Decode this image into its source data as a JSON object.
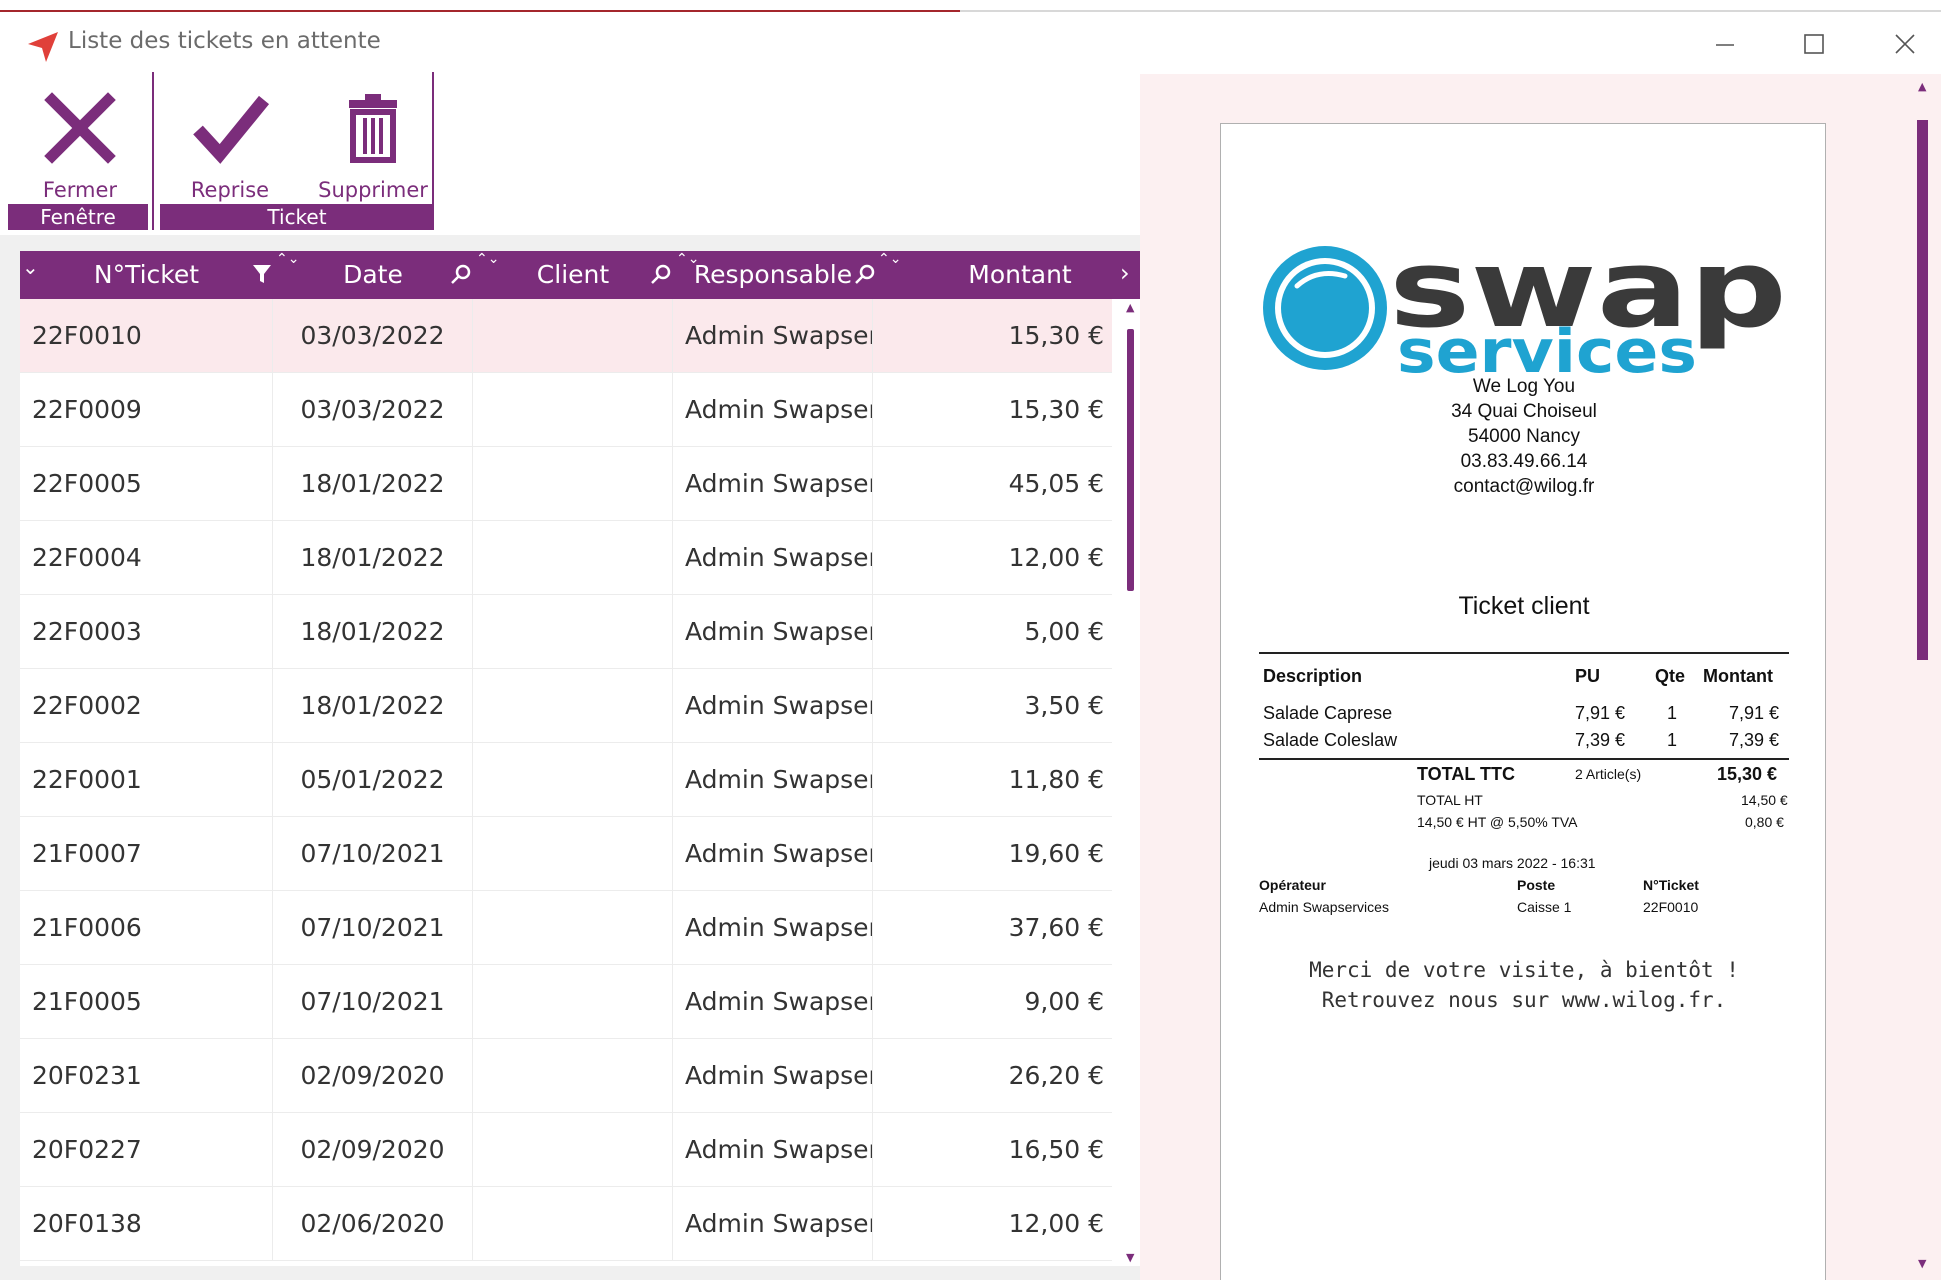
{
  "window": {
    "title": "Liste des tickets en attente",
    "controls": {
      "minimize": "minimize-icon",
      "maximize": "maximize-icon",
      "close": "close-icon"
    }
  },
  "ribbon": {
    "groups": [
      {
        "label": "Fenêtre",
        "buttons": [
          {
            "label": "Fermer",
            "icon": "close-x-icon"
          }
        ]
      },
      {
        "label": "Ticket",
        "buttons": [
          {
            "label": "Reprise",
            "icon": "checkmark-icon"
          },
          {
            "label": "Supprimer",
            "icon": "trash-icon"
          }
        ]
      }
    ],
    "accent": "#7b2d7b"
  },
  "grid": {
    "columns": [
      "N°Ticket",
      "Date",
      "Client",
      "Responsable",
      "Montant"
    ],
    "rows": [
      {
        "num": "22F0010",
        "date": "03/03/2022",
        "client": "",
        "resp": "Admin Swapserv",
        "montant": "15,30 €"
      },
      {
        "num": "22F0009",
        "date": "03/03/2022",
        "client": "",
        "resp": "Admin Swapserv",
        "montant": "15,30 €"
      },
      {
        "num": "22F0005",
        "date": "18/01/2022",
        "client": "",
        "resp": "Admin Swapserv",
        "montant": "45,05 €"
      },
      {
        "num": "22F0004",
        "date": "18/01/2022",
        "client": "",
        "resp": "Admin Swapserv",
        "montant": "12,00 €"
      },
      {
        "num": "22F0003",
        "date": "18/01/2022",
        "client": "",
        "resp": "Admin Swapserv",
        "montant": "5,00 €"
      },
      {
        "num": "22F0002",
        "date": "18/01/2022",
        "client": "",
        "resp": "Admin Swapserv",
        "montant": "3,50 €"
      },
      {
        "num": "22F0001",
        "date": "05/01/2022",
        "client": "",
        "resp": "Admin Swapserv",
        "montant": "11,80 €"
      },
      {
        "num": "21F0007",
        "date": "07/10/2021",
        "client": "",
        "resp": "Admin Swapserv",
        "montant": "19,60 €"
      },
      {
        "num": "21F0006",
        "date": "07/10/2021",
        "client": "",
        "resp": "Admin Swapserv",
        "montant": "37,60 €"
      },
      {
        "num": "21F0005",
        "date": "07/10/2021",
        "client": "",
        "resp": "Admin Swapserv",
        "montant": "9,00 €"
      },
      {
        "num": "20F0231",
        "date": "02/09/2020",
        "client": "",
        "resp": "Admin Swapserv",
        "montant": "26,20 €"
      },
      {
        "num": "20F0227",
        "date": "02/09/2020",
        "client": "",
        "resp": "Admin Swapserv",
        "montant": "16,50 €"
      },
      {
        "num": "20F0138",
        "date": "02/06/2020",
        "client": "",
        "resp": "Admin Swapserv",
        "montant": "12,00 €"
      }
    ],
    "selected_row": 0,
    "header_bg": "#7b2d7b",
    "selected_bg": "#fbe9ec"
  },
  "receipt": {
    "logo_main": "swap",
    "logo_sub": "services",
    "company": "We Log You",
    "address": "34 Quai Choiseul",
    "city": "54000 Nancy",
    "phone": "03.83.49.66.14",
    "email": "contact@wilog.fr",
    "heading": "Ticket client",
    "cols": {
      "description": "Description",
      "pu": "PU",
      "qte": "Qte",
      "montant": "Montant"
    },
    "items": [
      {
        "desc": "Salade Caprese",
        "pu": "7,91 €",
        "qte": "1",
        "montant": "7,91 €"
      },
      {
        "desc": "Salade Coleslaw",
        "pu": "7,39 €",
        "qte": "1",
        "montant": "7,39 €"
      }
    ],
    "total_ttc_label": "TOTAL TTC",
    "articles": "2 Article(s)",
    "total_ttc": "15,30 €",
    "total_ht_label": "TOTAL HT",
    "total_ht": "14,50 €",
    "tva_label": "14,50 € HT @ 5,50% TVA",
    "tva": "0,80 €",
    "datetime": "jeudi 03 mars 2022 - 16:31",
    "operateur_label": "Opérateur",
    "operateur": "Admin Swapservices",
    "poste_label": "Poste",
    "poste": "Caisse 1",
    "ticket_label": "N°Ticket",
    "ticket": "22F0010",
    "footer1": "Merci de votre visite, à bientôt !",
    "footer2": "Retrouvez nous sur www.wilog.fr.",
    "logo_dark": "#3a3a3a",
    "logo_blue": "#1fa3d1"
  }
}
